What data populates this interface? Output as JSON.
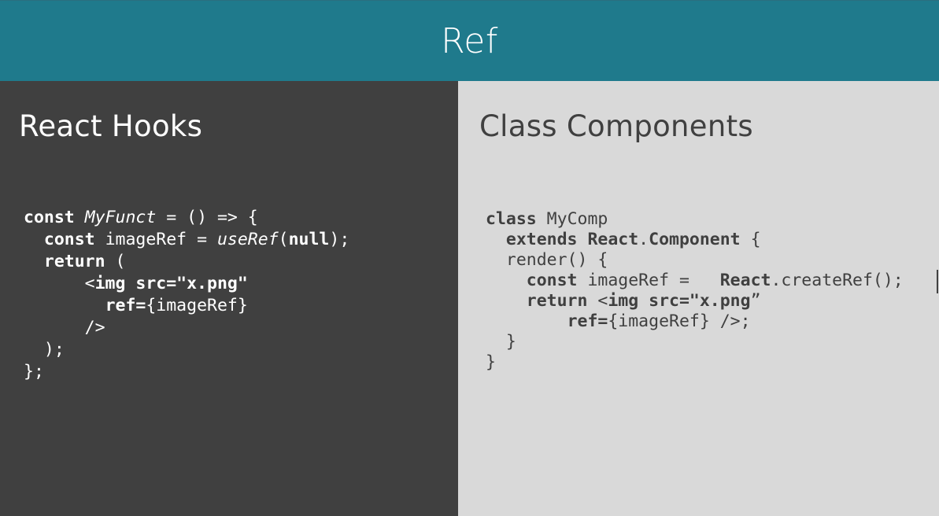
{
  "header": {
    "title": "Ref"
  },
  "left_panel": {
    "heading": "React Hooks",
    "code": [
      [
        {
          "text": "const",
          "style": "kw"
        },
        {
          "text": " "
        },
        {
          "text": "MyFunct",
          "style": "it"
        },
        {
          "text": " = () => {"
        }
      ],
      [
        {
          "text": "  "
        },
        {
          "text": "const",
          "style": "kw"
        },
        {
          "text": " imageRef = "
        },
        {
          "text": "useRef",
          "style": "it"
        },
        {
          "text": "("
        },
        {
          "text": "null",
          "style": "kw"
        },
        {
          "text": ");"
        }
      ],
      [
        {
          "text": "  "
        },
        {
          "text": "return",
          "style": "kw"
        },
        {
          "text": " ("
        }
      ],
      [
        {
          "text": "      <"
        },
        {
          "text": "img src=\"x.png\"",
          "style": "kw"
        }
      ],
      [
        {
          "text": "        "
        },
        {
          "text": "ref=",
          "style": "kw"
        },
        {
          "text": "{imageRef}"
        }
      ],
      [
        {
          "text": "      />"
        }
      ],
      [
        {
          "text": "  );"
        }
      ],
      [
        {
          "text": "};"
        }
      ]
    ]
  },
  "right_panel": {
    "heading": "Class Components",
    "code": [
      [
        {
          "text": "class",
          "style": "kw"
        },
        {
          "text": " MyComp"
        }
      ],
      [
        {
          "text": "  "
        },
        {
          "text": "extends React",
          "style": "kw"
        },
        {
          "text": "."
        },
        {
          "text": "Component",
          "style": "kw"
        },
        {
          "text": " {"
        }
      ],
      [
        {
          "text": "  render() {"
        }
      ],
      [
        {
          "text": "    "
        },
        {
          "text": "const",
          "style": "kw"
        },
        {
          "text": " imageRef =   "
        },
        {
          "text": "React",
          "style": "kw"
        },
        {
          "text": ".createRef();"
        }
      ],
      [
        {
          "text": "    "
        },
        {
          "text": "return",
          "style": "kw"
        },
        {
          "text": " <"
        },
        {
          "text": "img src=\"x.png",
          "style": "kw"
        },
        {
          "text": "”"
        }
      ],
      [
        {
          "text": "        "
        },
        {
          "text": "ref=",
          "style": "kw"
        },
        {
          "text": "{imageRef} />;"
        }
      ],
      [
        {
          "text": "  }"
        }
      ],
      [
        {
          "text": "}"
        }
      ]
    ]
  }
}
